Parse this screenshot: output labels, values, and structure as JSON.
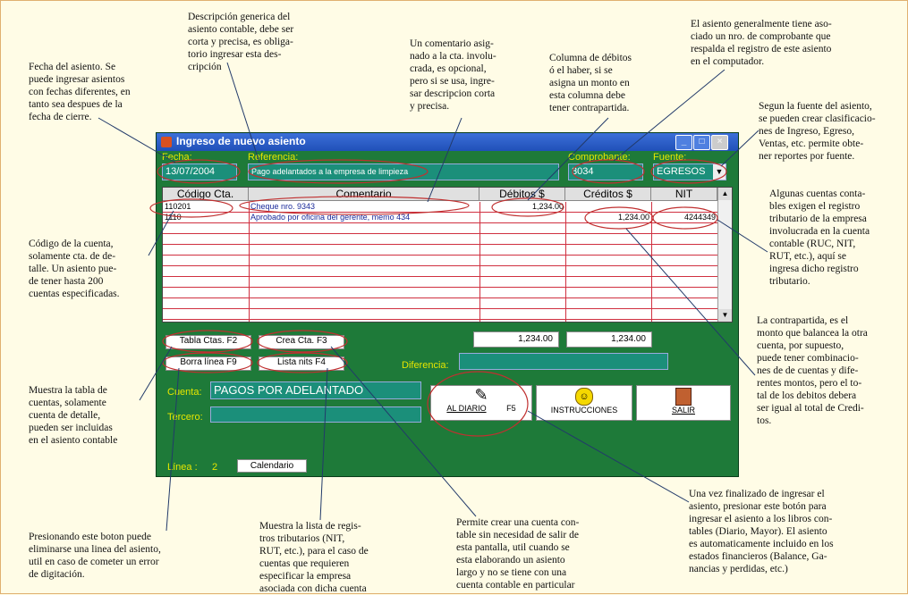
{
  "annotations": {
    "fecha": "Fecha del asiento. Se\npuede ingresar asientos\ncon fechas diferentes, en\ntanto sea despues de la\nfecha de cierre.",
    "descripcion": "Descripción generica del\nasiento contable, debe ser\ncorta y precisa, es obliga-\ntorio ingresar esta des-\ncripción",
    "comentario": "Un comentario asig-\nnado a la cta. involu-\ncrada, es opcional,\npero si se usa, ingre-\nsar descripcion corta\ny precisa.",
    "debitos": "Columna de débitos\nó el haber, si se\nasigna un monto en\nesta columna debe\ntener contrapartida.",
    "comprobante": "El asiento generalmente tiene aso-\nciado un nro. de comprobante que\nrespalda el registro de este asiento\nen el computador.",
    "fuente": "Segun la fuente del asiento,\nse pueden crear clasificacio-\nnes de Ingreso, Egreso,\nVentas, etc. permite obte-\nner reportes por fuente.",
    "nit": "Algunas cuentas conta-\nbles exigen el registro\ntributario de la empresa\ninvolucrada en la cuenta\ncontable (RUC, NIT,\nRUT, etc.), aquí se\ningresa dicho registro\ntributario.",
    "codigo": "Código de la cuenta,\nsolamente cta. de de-\ntalle. Un asiento pue-\nde tener hasta 200\ncuentas especificadas.",
    "contrapartida": "La contrapartida, es el\nmonto que balancea la otra\ncuenta, por supuesto,\npuede tener combinacio-\nnes de de cuentas y dife-\nrentes montos, pero el to-\ntal de los debitos debera\nser igual al total de Credi-\ntos.",
    "tabla": "Muestra la tabla de\ncuentas, solamente\ncuenta de detalle,\npueden ser incluidas\nen el asiento contable",
    "borra": "Presionando este boton puede\neliminarse una linea del asiento,\nutil en caso de cometer un error\nde digitación.",
    "lista": "Muestra la lista de regis-\ntros tributarios (NIT,\nRUT, etc.), para el caso de\ncuentas que requieren\nespecificar la empresa\nasociada con dicha cuenta",
    "crea": "Permite crear una cuenta con-\ntable sin necesidad de salir de\nesta pantalla, util cuando se\nesta elaborando un asiento\nlargo y no se tiene con una\ncuenta contable en particular",
    "diario": "Una vez finalizado de ingresar el\nasiento, presionar este botón para\ningresar el asiento a los libros con-\ntables (Diario, Mayor). El asiento\nes automaticamente incluido en los\nestados financieros (Balance, Ga-\nnancias y perdidas, etc.)"
  },
  "window": {
    "title": "Ingreso de nuevo asiento",
    "min": "_",
    "max": "□",
    "close": "×"
  },
  "form": {
    "fecha_label": "Fecha:",
    "fecha_value": "13/07/2004",
    "referencia_label": "Referencia:",
    "referencia_value": "Pago adelantados a la empresa de limpieza",
    "comprobante_label": "Comprobante:",
    "comprobante_value": "3034",
    "fuente_label": "Fuente:",
    "fuente_value": "EGRESOS"
  },
  "grid": {
    "headers": [
      "Código Cta.",
      "Comentario",
      "Débitos $",
      "Créditos $",
      "NIT"
    ],
    "rows": [
      {
        "codigo": "110201",
        "comentario": "Cheque nro. 9343",
        "debitos": "1,234.00",
        "creditos": "",
        "nit": ""
      },
      {
        "codigo": "1110",
        "comentario": "Aprobado por oficina del gerente, memo 434",
        "debitos": "",
        "creditos": "1,234.00",
        "nit": "4244349"
      }
    ]
  },
  "buttons": {
    "tabla": "Tabla Ctas.  F2",
    "crea": "Crea Cta.    F3",
    "borra": "Borra línea  F9",
    "lista": "Lista nits    F4",
    "diario": "AL DIARIO",
    "diario_key": "F5",
    "instrucciones": "INSTRUCCIONES",
    "salir": "SALIR",
    "calendario": "Calendario"
  },
  "totals": {
    "debitos": "1,234.00",
    "creditos": "1,234.00",
    "diferencia_label": "Diferencia:",
    "diferencia_value": ""
  },
  "fields": {
    "cuenta_label": "Cuenta:",
    "cuenta_value": "PAGOS POR ADELANTADO",
    "tercero_label": "Tercero:",
    "tercero_value": "",
    "linea_label": "Línea :",
    "linea_value": "2"
  },
  "colors": {
    "window_bg": "#1e7a39",
    "title_bar": "#2f5fcf",
    "field_bg": "#1b8f7a",
    "label_yellow": "#e6e600",
    "annotation_circle": "#c03030"
  }
}
